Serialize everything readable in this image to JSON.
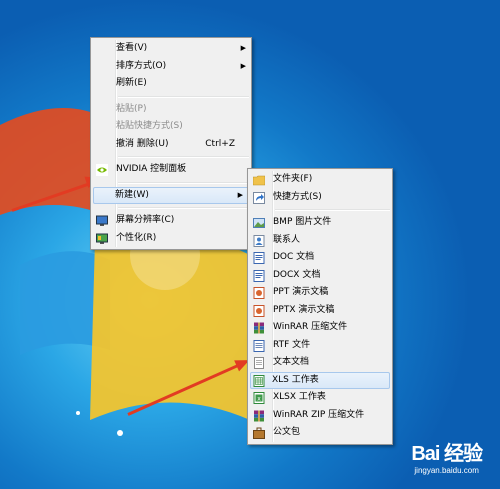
{
  "context_menu": {
    "items": [
      {
        "label": "查看(V)"
      },
      {
        "label": "排序方式(O)"
      },
      {
        "label": "刷新(E)"
      },
      {
        "label": "粘贴(P)"
      },
      {
        "label": "粘贴快捷方式(S)"
      },
      {
        "label": "撤消 删除(U)",
        "shortcut": "Ctrl+Z"
      },
      {
        "label": "NVIDIA 控制面板"
      },
      {
        "label": "新建(W)"
      },
      {
        "label": "屏幕分辨率(C)"
      },
      {
        "label": "个性化(R)"
      }
    ]
  },
  "submenu": {
    "items": [
      {
        "label": "文件夹(F)"
      },
      {
        "label": "快捷方式(S)"
      },
      {
        "label": "BMP 图片文件"
      },
      {
        "label": "联系人"
      },
      {
        "label": "DOC 文档"
      },
      {
        "label": "DOCX 文档"
      },
      {
        "label": "PPT 演示文稿"
      },
      {
        "label": "PPTX 演示文稿"
      },
      {
        "label": "WinRAR 压缩文件"
      },
      {
        "label": "RTF 文件"
      },
      {
        "label": "文本文档"
      },
      {
        "label": "XLS 工作表"
      },
      {
        "label": "XLSX 工作表"
      },
      {
        "label": "WinRAR ZIP 压缩文件"
      },
      {
        "label": "公文包"
      }
    ]
  },
  "watermark": {
    "logo": "Bai 经验",
    "url": "jingyan.baidu.com"
  },
  "colors": {
    "annotation_arrow": "#e23b22",
    "menu_bg": "#f0f0f0",
    "highlight": "#d9e8f8"
  }
}
